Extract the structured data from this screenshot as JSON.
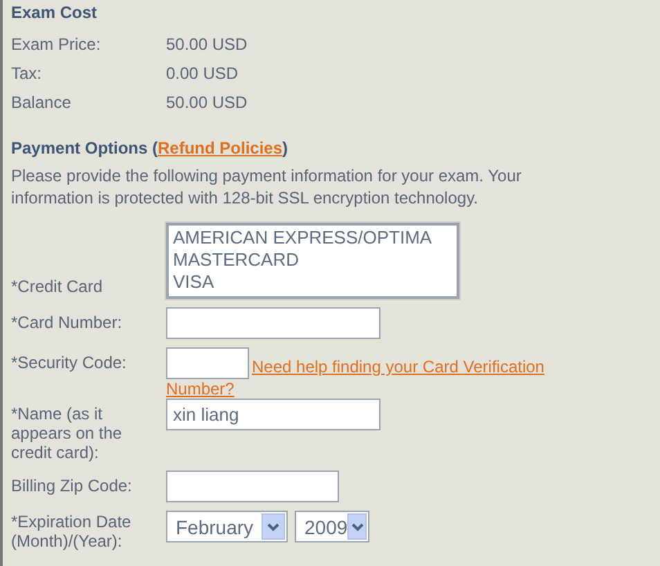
{
  "exam_cost": {
    "title": "Exam Cost",
    "rows": [
      {
        "label": "Exam Price:",
        "value": "50.00 USD"
      },
      {
        "label": "Tax:",
        "value": "0.00 USD"
      },
      {
        "label": "Balance",
        "value": "50.00 USD"
      }
    ]
  },
  "payment_options": {
    "title": "Payment Options (",
    "link": "Refund Policies",
    "title_end": ")",
    "intro": "Please provide the following payment information for your exam. Your information is protected with 128-bit SSL encryption technology.",
    "fields": [
      {
        "kind": "listbox",
        "label": "*Credit Card",
        "options": [
          {
            "text": "AMERICAN EXPRESS/OPTIMA",
            "selected": false
          },
          {
            "text": "MASTERCARD",
            "selected": false
          },
          {
            "text": "VISA",
            "selected": false
          }
        ]
      },
      {
        "kind": "text",
        "label": "*Card Number:"
      },
      {
        "kind": "text",
        "label": "*Security Code:",
        "help_link": "Need help finding your Card Verification Number?"
      },
      {
        "kind": "text",
        "label": "*Name (as it appears on the credit card):",
        "value": "xin liang"
      },
      {
        "kind": "text",
        "label": "Billing Zip Code:"
      },
      {
        "kind": "date",
        "label": "*Expiration Date (Month)/(Year):",
        "month": "February",
        "year": "2009"
      }
    ]
  }
}
